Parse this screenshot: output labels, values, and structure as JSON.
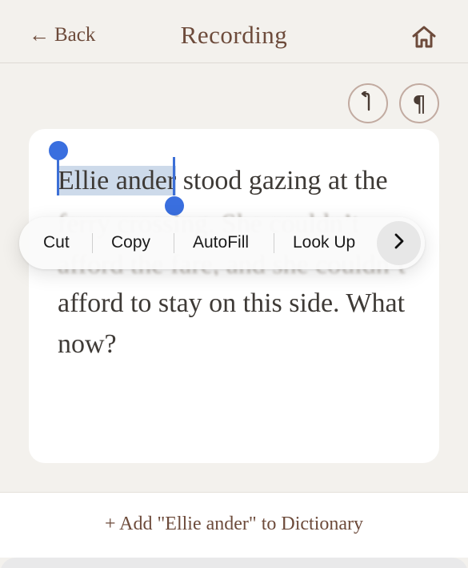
{
  "header": {
    "back_label": "Back",
    "back_arrow": "←",
    "title": "Recording",
    "home_icon": "home-icon"
  },
  "toolbar": {
    "undo_icon": "undo-icon",
    "paragraph_symbol": "¶"
  },
  "editor": {
    "selected_text": "Ellie ander",
    "line1_rest": " stood gazing at the",
    "line2": "ferry crossing. She couldn’t",
    "line3": "afford the fare, and she couldn’t",
    "line4": "afford to stay on this side. What",
    "line5": "now?"
  },
  "context_menu": {
    "items": [
      "Cut",
      "Copy",
      "AutoFill",
      "Look Up"
    ],
    "next_icon": "chevron-right-icon"
  },
  "bottom": {
    "add_dictionary": "+ Add \"Ellie ander\" to Dictionary"
  },
  "colors": {
    "accent": "#6d4b3b",
    "selection": "#cddaea",
    "handle": "#3a6fdf",
    "background": "#f3f1ed"
  }
}
